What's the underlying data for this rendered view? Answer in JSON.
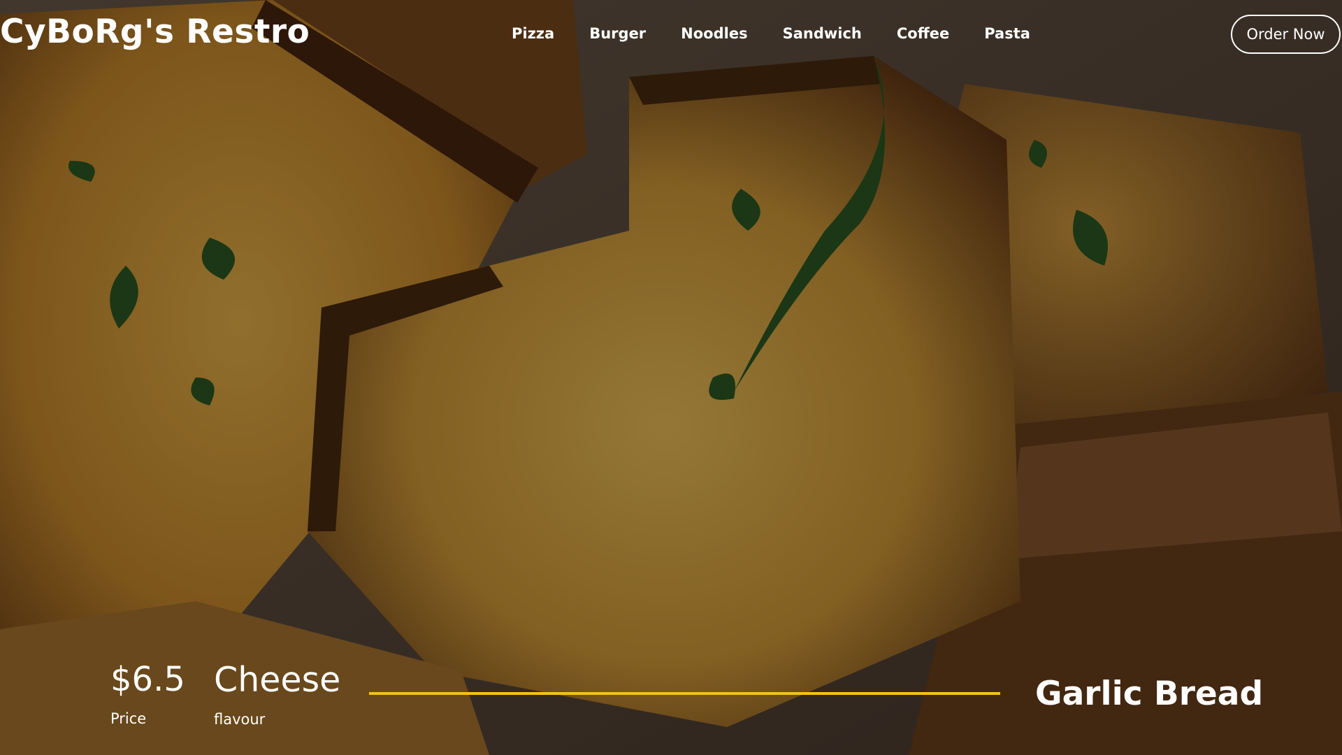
{
  "header": {
    "brand": "CyBoRg's Restro",
    "nav": [
      "Pizza",
      "Burger",
      "Noodles",
      "Sandwich",
      "Coffee",
      "Pasta"
    ],
    "cta": "Order Now"
  },
  "product": {
    "price": "$6.5",
    "price_label": "Price",
    "flavour": "Cheese",
    "flavour_label": "flavour",
    "name": "Garlic Bread"
  },
  "colors": {
    "accent": "#f2c314",
    "text": "#ffffff",
    "bread": "#b5802e",
    "crust": "#3d2412",
    "herb": "#2c5a23"
  }
}
